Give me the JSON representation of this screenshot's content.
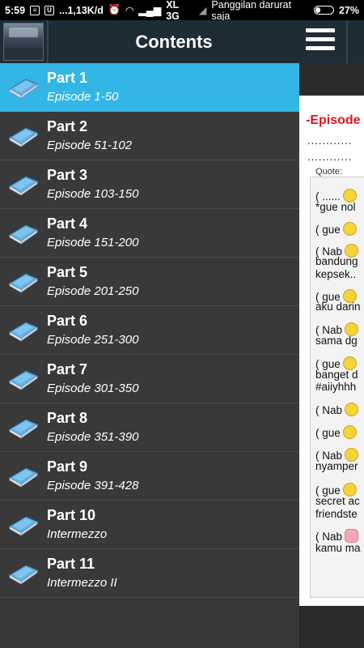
{
  "status_bar": {
    "time": "5:59",
    "dots": "...",
    "data_rate": "1,13K/d",
    "network": "XL 3G",
    "carrier_note": "Panggilan darurat saja",
    "battery_percent": "27%",
    "battery_level": 0.27
  },
  "drawer": {
    "title": "Contents",
    "items": [
      {
        "title": "Part 1",
        "subtitle": "Episode 1-50",
        "active": true
      },
      {
        "title": "Part 2",
        "subtitle": "Episode 51-102"
      },
      {
        "title": "Part 3",
        "subtitle": "Episode 103-150"
      },
      {
        "title": "Part 4",
        "subtitle": "Episode 151-200"
      },
      {
        "title": "Part 5",
        "subtitle": "Episode 201-250"
      },
      {
        "title": "Part 6",
        "subtitle": "Episode 251-300"
      },
      {
        "title": "Part 7",
        "subtitle": "Episode 301-350"
      },
      {
        "title": "Part 8",
        "subtitle": "Episode 351-390"
      },
      {
        "title": "Part 9",
        "subtitle": "Episode 391-428"
      },
      {
        "title": "Part 10",
        "subtitle": "Intermezzo"
      },
      {
        "title": "Part 11",
        "subtitle": "Intermezzo II"
      }
    ]
  },
  "main": {
    "menu_icon": "hamburger-icon",
    "episode_title": "-Episode",
    "dots_1": "............",
    "dots_2": "............",
    "quote_label": "Quote:",
    "quote_lines": [
      "( ......",
      "*gue nol",
      "( gue",
      "( Nab",
      "bandung",
      "kepsek..",
      "( gue",
      "aku darin",
      "( Nab",
      "sama dg",
      "( gue",
      "banget d",
      "#aiiyhhh",
      "( Nab",
      "( gue",
      "( Nab",
      "nyamper",
      "( gue",
      "secret ac",
      "friendste",
      "( Nab",
      "kamu ma"
    ]
  },
  "colors": {
    "header_bg": "#1e2c36",
    "drawer_bg": "#393939",
    "active_item": "#33b5e5",
    "episode_title": "#e0161a"
  }
}
